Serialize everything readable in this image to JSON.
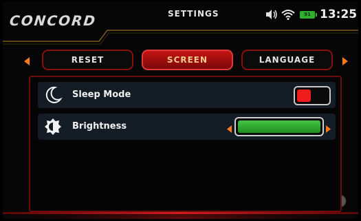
{
  "header": {
    "brand": "CONCORD",
    "title": "SETTINGS",
    "time": "13:25",
    "battery_label": "91"
  },
  "tabs": [
    {
      "label": "RESET",
      "active": false
    },
    {
      "label": "SCREEN",
      "active": true
    },
    {
      "label": "LANGUAGE",
      "active": false
    }
  ],
  "settings": {
    "sleep_mode": {
      "label": "Sleep Mode",
      "enabled": false
    },
    "brightness": {
      "label": "Brightness",
      "level": 1.0
    }
  },
  "colors": {
    "accent_red": "#c51414",
    "toggle_red": "#ee1c1c",
    "slider_green": "#2fb12f",
    "row_bg": "#141c26"
  },
  "icons": [
    "speaker-icon",
    "wifi-icon",
    "battery-icon",
    "moon-icon",
    "brightness-icon",
    "arrow-left-icon",
    "arrow-right-icon"
  ]
}
